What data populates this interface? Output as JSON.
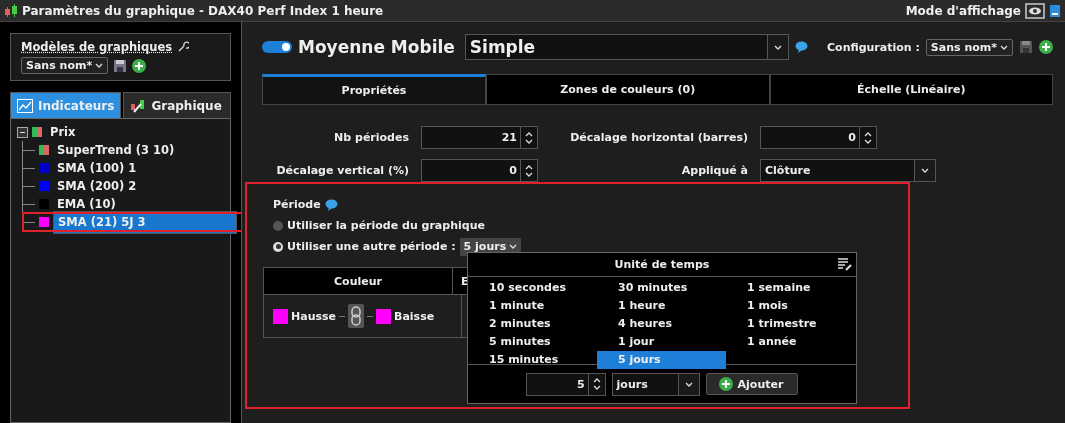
{
  "window": {
    "title": "Paramètres du graphique - DAX40 Perf Index 1 heure",
    "display_mode": "Mode d'affichage"
  },
  "templates": {
    "label": "Modèles de graphiques",
    "value": "Sans nom*"
  },
  "left_tabs": [
    {
      "label": "Indicateurs",
      "selected": true
    },
    {
      "label": "Graphique",
      "selected": false
    }
  ],
  "tree": {
    "label": "Prix",
    "expanded": true,
    "selected": false,
    "children": [
      {
        "label": "SuperTrend (3 10)",
        "selected": false,
        "highlighted": false
      },
      {
        "label": "SMA (100) 1",
        "color": "#0000cc",
        "selected": false,
        "highlighted": false
      },
      {
        "label": "SMA (200) 2",
        "color": "#0000ff",
        "selected": false,
        "highlighted": false
      },
      {
        "label": "EMA (10)",
        "color": "#000000",
        "selected": false,
        "highlighted": false
      },
      {
        "label": "SMA (21) 5J 3",
        "color": "#ff00ff",
        "selected": true,
        "highlighted": true
      }
    ]
  },
  "indicator": {
    "enabled": true,
    "name": "Moyenne Mobile",
    "type": "Simple"
  },
  "configuration": {
    "label": "Configuration :",
    "value": "Sans nom*"
  },
  "tabs": [
    {
      "label": "Propriétés",
      "selected": true
    },
    {
      "label": "Zones de couleurs (0)",
      "selected": false
    },
    {
      "label": "Échelle (Linéaire)",
      "selected": false
    }
  ],
  "fields": [
    {
      "label": "Nb périodes",
      "value": "21",
      "kind": "spin"
    },
    {
      "label": "Décalage horizontal (barres)",
      "value": "0",
      "kind": "spin"
    },
    {
      "label": "Décalage vertical (%)",
      "value": "0",
      "kind": "spin"
    },
    {
      "label": "Appliqué à",
      "value": "Clôture",
      "kind": "select"
    }
  ],
  "period": {
    "label": "Période",
    "highlighted": true,
    "options": [
      {
        "label": "Utiliser la période du graphique",
        "selected": false
      },
      {
        "label": "Utiliser une autre période :",
        "selected": true
      }
    ],
    "value": "5 jours"
  },
  "color_table": {
    "columns": [
      "Couleur",
      "E"
    ],
    "swatches": [
      {
        "label": "Hausse",
        "color": "#ff00ff"
      },
      {
        "label": "Baisse",
        "color": "#ff00ff"
      }
    ]
  },
  "time_unit_popup": {
    "title": "Unité de temps",
    "columns": [
      [
        {
          "label": "10 secondes",
          "selected": false
        },
        {
          "label": "1 minute",
          "selected": false
        },
        {
          "label": "2 minutes",
          "selected": false
        },
        {
          "label": "5 minutes",
          "selected": false
        },
        {
          "label": "15 minutes",
          "selected": false
        }
      ],
      [
        {
          "label": "30 minutes",
          "selected": false
        },
        {
          "label": "1 heure",
          "selected": false
        },
        {
          "label": "4 heures",
          "selected": false
        },
        {
          "label": "1 jour",
          "selected": false
        },
        {
          "label": "5 jours",
          "selected": true
        }
      ],
      [
        {
          "label": "1 semaine",
          "selected": false
        },
        {
          "label": "1 mois",
          "selected": false
        },
        {
          "label": "1 trimestre",
          "selected": false
        },
        {
          "label": "1 année",
          "selected": false
        }
      ]
    ],
    "count": "5",
    "unit": "jours",
    "add_label": "Ajouter"
  }
}
